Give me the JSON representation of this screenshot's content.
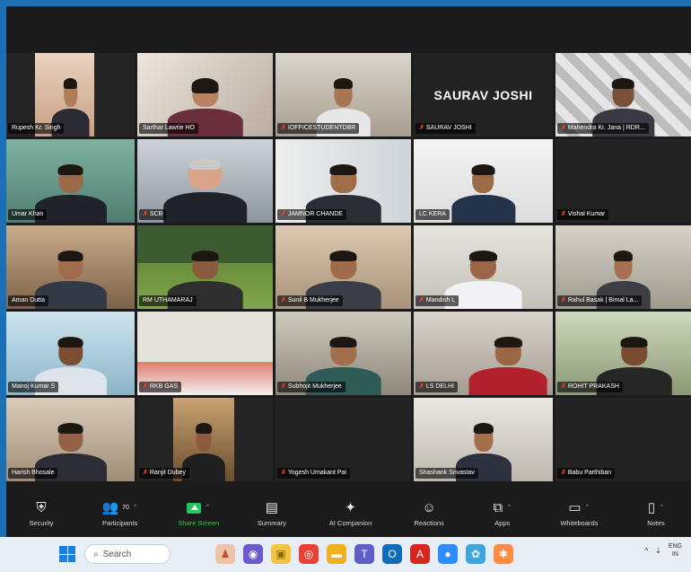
{
  "gallery": {
    "tiles": [
      {
        "name": "Rupesh Kr. Singh",
        "muted": false
      },
      {
        "name": "Sarthar Lawrie HO",
        "muted": false
      },
      {
        "name": "IOFFICESTUDENTDBR",
        "muted": true
      },
      {
        "name": "SAURAV JOSHI",
        "muted": true,
        "name_only": "SAURAV JOSHI"
      },
      {
        "name": "Mahendra Kr. Jana | RDR...",
        "muted": true
      },
      {
        "name": "Umar Khan",
        "muted": false
      },
      {
        "name": "SCB",
        "muted": true
      },
      {
        "name": "JAMNOR CHANDE",
        "muted": true
      },
      {
        "name": "LC KERA",
        "muted": false
      },
      {
        "name": "Vishal Kumar",
        "muted": true
      },
      {
        "name": "Aman Dutta",
        "muted": false
      },
      {
        "name": "RM UTHAMARAJ",
        "muted": false
      },
      {
        "name": "Sunil B Mukherjee",
        "muted": true
      },
      {
        "name": "Mandish L",
        "muted": true
      },
      {
        "name": "Rahul Basak | Bimal La...",
        "muted": true
      },
      {
        "name": "Manoj Kumar S",
        "muted": false
      },
      {
        "name": "RKB GAS",
        "muted": true
      },
      {
        "name": "Subhojit Mukherjee",
        "muted": true
      },
      {
        "name": "LS DELHI",
        "muted": true
      },
      {
        "name": "ROHIT PRAKASH",
        "muted": true
      },
      {
        "name": "Harish Bhosale",
        "muted": false
      },
      {
        "name": "Ranjit Dubey",
        "muted": true
      },
      {
        "name": "Yogesh Umakant Pai",
        "muted": true
      },
      {
        "name": "Shashank Srivastav",
        "muted": false
      },
      {
        "name": "Babu Parthiban",
        "muted": true
      }
    ]
  },
  "toolbar": {
    "items": [
      {
        "label": "Security",
        "icon": "shield-icon"
      },
      {
        "label": "Participants",
        "icon": "participants-icon",
        "count": "70"
      },
      {
        "label": "Share Screen",
        "icon": "share-screen-icon"
      },
      {
        "label": "Summary",
        "icon": "summary-icon"
      },
      {
        "label": "AI Companion",
        "icon": "ai-companion-icon"
      },
      {
        "label": "Reactions",
        "icon": "reactions-icon"
      },
      {
        "label": "Apps",
        "icon": "apps-icon"
      },
      {
        "label": "Whiteboards",
        "icon": "whiteboards-icon"
      },
      {
        "label": "Notes",
        "icon": "notes-icon"
      }
    ]
  },
  "taskbar": {
    "search_placeholder": "Search",
    "lang_top": "ENG",
    "lang_bottom": "IN"
  },
  "colors": {
    "toolbar_bg": "#1b1b1b",
    "share_green": "#22c55e",
    "active_speaker_border": "#c8e86a",
    "taskbar_bg": "#e8eef6"
  }
}
